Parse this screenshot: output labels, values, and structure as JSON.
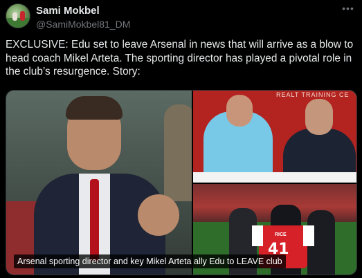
{
  "tweet": {
    "author_name": "Sami Mokbel",
    "author_handle": "@SamiMokbel81_DM",
    "more_icon": "ellipsis-icon",
    "text": "EXCLUSIVE: Edu set to leave Arsenal in news that will arrive as a blow to head coach Mikel Arteta. The sporting director has played a pivotal role in the club’s resurgence. Story:",
    "media": {
      "caption": "Arsenal sporting director and key Mikel Arteta ally Edu to LEAVE club",
      "board_text": "REALT TRAINING CE",
      "jersey_name": "RICE",
      "jersey_number": "41"
    }
  },
  "colors": {
    "background": "#000000",
    "text_primary": "#e7e9ea",
    "text_secondary": "#71767b",
    "arsenal_red": "#d72128"
  }
}
